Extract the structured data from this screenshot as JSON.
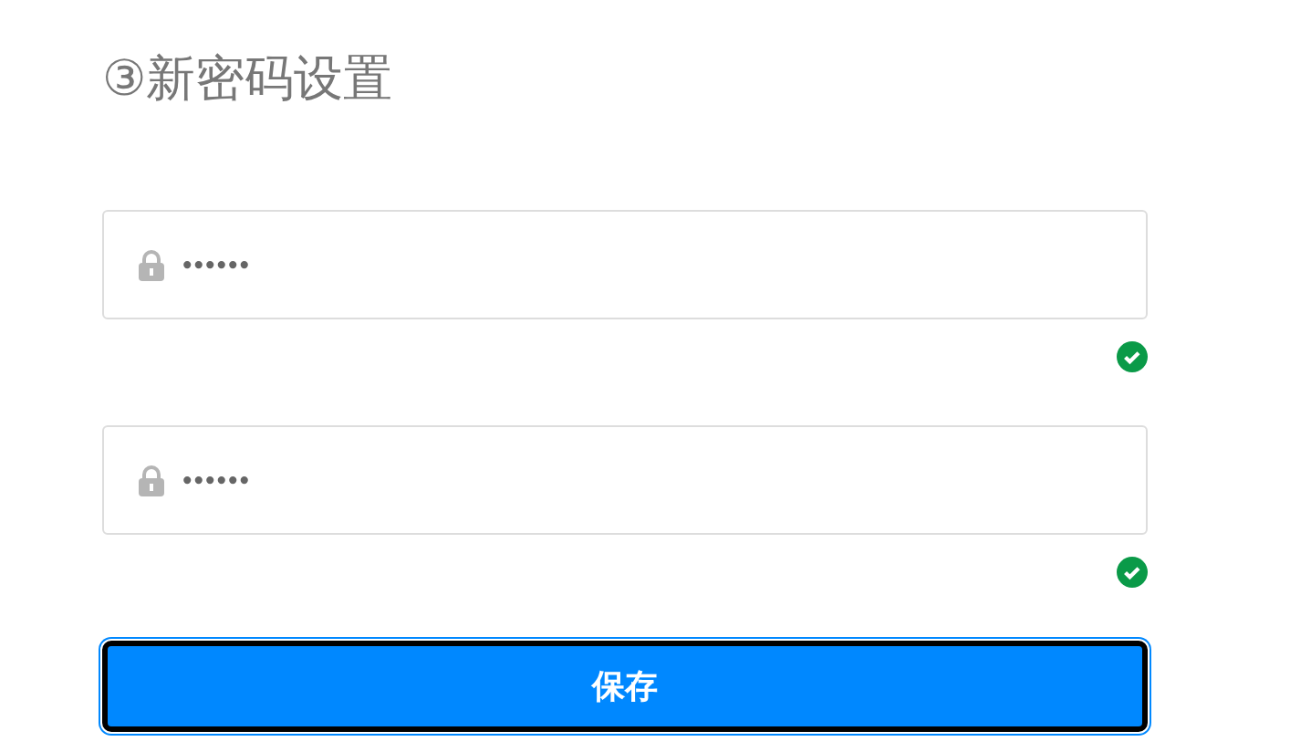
{
  "title": "③新密码设置",
  "fields": [
    {
      "value": "••••••",
      "valid": true
    },
    {
      "value": "••••••",
      "valid": true
    }
  ],
  "button": {
    "label": "保存",
    "focused": true
  }
}
